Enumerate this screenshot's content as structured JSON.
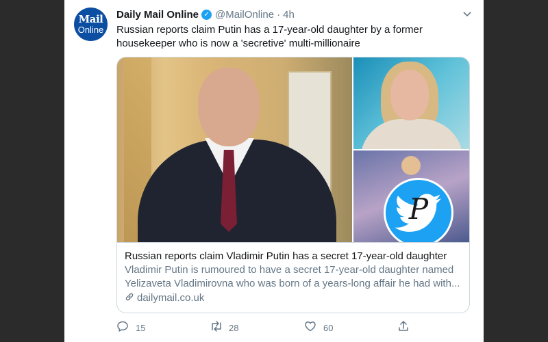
{
  "tweet": {
    "avatar": {
      "line1": "Mail",
      "line2": "Online",
      "icon": "daily-mail-logo"
    },
    "author_name": "Daily Mail Online",
    "verified_icon": "verified-badge-icon",
    "handle": "@MailOnline",
    "separator": "·",
    "time": "4h",
    "text": "Russian reports claim Putin has a 17-year-old daughter by a former housekeeper who is now a 'secretive' multi-millionaire"
  },
  "card": {
    "title": "Russian reports claim Vladimir Putin has a secret 17-year-old daughter",
    "description": "Vladimir Putin is rumoured to have a secret 17-year-old daughter named Yelizaveta Vladimirovna who was born of a years-long affair he had with...",
    "domain": "dailymail.co.uk",
    "watermark_letter": "P"
  },
  "actions": {
    "replies": "15",
    "retweets": "28",
    "likes": "60"
  },
  "colors": {
    "accent": "#1da1f2",
    "secondary_text": "#657786",
    "border": "#ccd6dd"
  }
}
